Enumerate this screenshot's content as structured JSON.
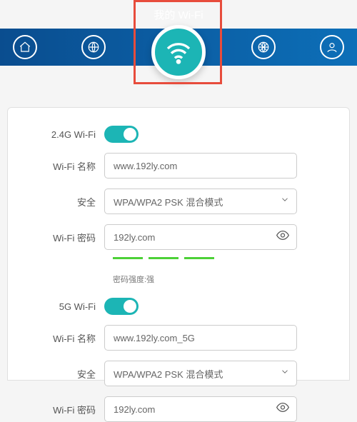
{
  "page_title": "我的 Wi-Fi",
  "wifi_24g": {
    "band_label": "2.4G Wi-Fi",
    "enabled": true,
    "name_label": "Wi-Fi 名称",
    "name_value": "www.192ly.com",
    "security_label": "安全",
    "security_value": "WPA/WPA2 PSK 混合模式",
    "password_label": "Wi-Fi 密码",
    "password_value": "192ly.com",
    "strength_text": "密码强度:强"
  },
  "wifi_5g": {
    "band_label": "5G Wi-Fi",
    "enabled": true,
    "name_label": "Wi-Fi 名称",
    "name_value": "www.192ly.com_5G",
    "security_label": "安全",
    "security_value": "WPA/WPA2 PSK 混合模式",
    "password_label": "Wi-Fi 密码",
    "password_value": "192ly.com"
  }
}
